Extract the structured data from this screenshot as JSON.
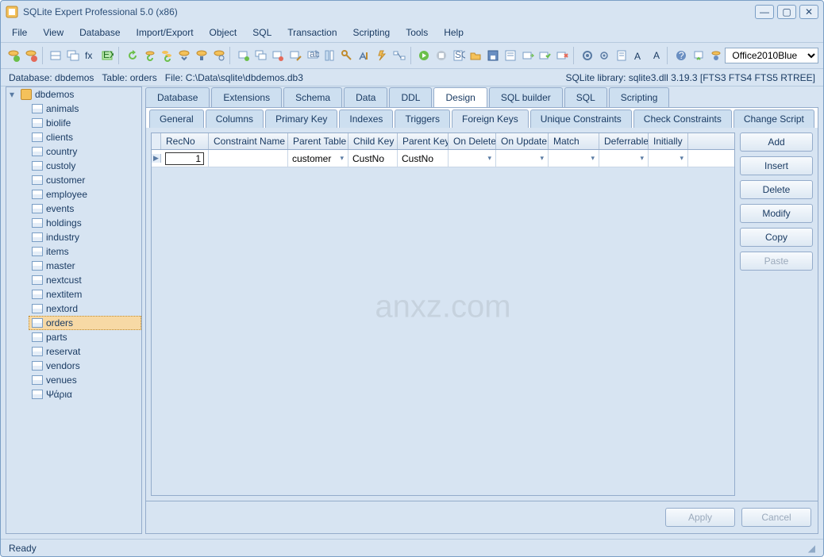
{
  "title": "SQLite Expert Professional 5.0 (x86)",
  "menu": [
    "File",
    "View",
    "Database",
    "Import/Export",
    "Object",
    "SQL",
    "Transaction",
    "Scripting",
    "Tools",
    "Help"
  ],
  "theme_selected": "Office2010Blue",
  "infobar": {
    "database": "Database: dbdemos",
    "table": "Table: orders",
    "file": "File: C:\\Data\\sqlite\\dbdemos.db3",
    "library": "SQLite library: sqlite3.dll 3.19.3 [FTS3 FTS4 FTS5 RTREE]"
  },
  "tree": {
    "root": "dbdemos",
    "tables": [
      "animals",
      "biolife",
      "clients",
      "country",
      "custoly",
      "customer",
      "employee",
      "events",
      "holdings",
      "industry",
      "items",
      "master",
      "nextcust",
      "nextitem",
      "nextord",
      "orders",
      "parts",
      "reservat",
      "vendors",
      "venues",
      "Ψάρια"
    ],
    "selected": "orders"
  },
  "tabs": {
    "main": [
      "Database",
      "Extensions",
      "Schema",
      "Data",
      "DDL",
      "Design",
      "SQL builder",
      "SQL",
      "Scripting"
    ],
    "main_active": "Design",
    "sub": [
      "General",
      "Columns",
      "Primary Key",
      "Indexes",
      "Triggers",
      "Foreign Keys",
      "Unique Constraints",
      "Check Constraints",
      "Change Script"
    ],
    "sub_active": "Foreign Keys"
  },
  "grid": {
    "columns": [
      {
        "name": "RecNo",
        "w": 60
      },
      {
        "name": "Constraint Name",
        "w": 100
      },
      {
        "name": "Parent Table",
        "w": 76
      },
      {
        "name": "Child Key",
        "w": 62
      },
      {
        "name": "Parent Key",
        "w": 64
      },
      {
        "name": "On Delete",
        "w": 60
      },
      {
        "name": "On Update",
        "w": 66
      },
      {
        "name": "Match",
        "w": 64
      },
      {
        "name": "Deferrable",
        "w": 62
      },
      {
        "name": "Initially",
        "w": 50
      }
    ],
    "row": {
      "RecNo": "1",
      "Constraint Name": "",
      "Parent Table": "customer",
      "Child Key": "CustNo",
      "Parent Key": "CustNo",
      "On Delete": "",
      "On Update": "",
      "Match": "",
      "Deferrable": "",
      "Initially": ""
    }
  },
  "side_buttons": [
    "Add",
    "Insert",
    "Delete",
    "Modify",
    "Copy",
    "Paste"
  ],
  "bottom_buttons": [
    "Apply",
    "Cancel"
  ],
  "status": "Ready",
  "watermark": "anxz.com"
}
